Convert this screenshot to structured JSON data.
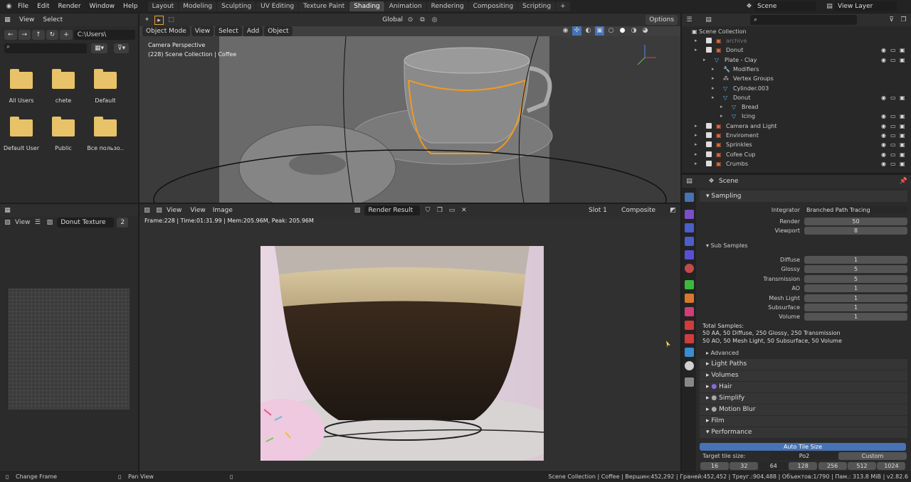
{
  "topbar": {
    "menus": [
      "File",
      "Edit",
      "Render",
      "Window",
      "Help"
    ],
    "workspaces": [
      "Layout",
      "Modeling",
      "Sculpting",
      "UV Editing",
      "Texture Paint",
      "Shading",
      "Animation",
      "Rendering",
      "Compositing",
      "Scripting"
    ],
    "scene": "Scene",
    "view_layer": "View Layer"
  },
  "file_browser": {
    "view": "View",
    "select": "Select",
    "path": "C:\\Users\\",
    "folders": [
      "All Users",
      "chete",
      "Default",
      "Default User",
      "Public",
      "Все пользо.."
    ]
  },
  "viewport": {
    "mode": "Object Mode",
    "menus": [
      "View",
      "Select",
      "Add",
      "Object"
    ],
    "transform": "Global",
    "options": "Options",
    "camera_label": "Camera Perspective",
    "collection_label": "(228) Scene Collection | Coffee"
  },
  "image_editor_left": {
    "view": "View",
    "image_name": "Donut Texture",
    "users": "2"
  },
  "image_editor": {
    "view": "View",
    "view2": "View",
    "image": "Image",
    "render_result": "Render Result",
    "slot": "Slot 1",
    "composite": "Composite",
    "frame_info": "Frame:228 | Time:01:31.99 | Mem:205.96M, Peak: 205.96M"
  },
  "outliner": {
    "title": "Scene Collection",
    "rows": [
      {
        "label": "archive",
        "indent": 0,
        "type": "collection",
        "dim": true
      },
      {
        "label": "Donut",
        "indent": 0,
        "type": "collection"
      },
      {
        "label": "Plate - Clay",
        "indent": 1,
        "type": "mesh"
      },
      {
        "label": "Modifiers",
        "indent": 2,
        "type": "wrench"
      },
      {
        "label": "Vertex Groups",
        "indent": 2,
        "type": "groups"
      },
      {
        "label": "Cylinder.003",
        "indent": 2,
        "type": "mesh"
      },
      {
        "label": "Donut",
        "indent": 2,
        "type": "mesh"
      },
      {
        "label": "Bread",
        "indent": 3,
        "type": "mesh"
      },
      {
        "label": "Icing",
        "indent": 3,
        "type": "mesh"
      },
      {
        "label": "Camera and Light",
        "indent": 0,
        "type": "collection"
      },
      {
        "label": "Enviroment",
        "indent": 0,
        "type": "collection"
      },
      {
        "label": "Sprinkles",
        "indent": 0,
        "type": "collection"
      },
      {
        "label": "Cofee Cup",
        "indent": 0,
        "type": "collection"
      },
      {
        "label": "Crumbs",
        "indent": 0,
        "type": "collection"
      }
    ]
  },
  "properties": {
    "context": "Scene",
    "sampling": "Sampling",
    "integrator_label": "Integrator",
    "integrator": "Branched Path Tracing",
    "render_label": "Render",
    "render_val": "50",
    "viewport_label": "Viewport",
    "viewport_val": "8",
    "sub_samples": "Sub Samples",
    "subs": [
      {
        "label": "Diffuse",
        "value": "1"
      },
      {
        "label": "Glossy",
        "value": "5"
      },
      {
        "label": "Transmission",
        "value": "5"
      },
      {
        "label": "AO",
        "value": "1"
      },
      {
        "label": "Mesh Light",
        "value": "1"
      },
      {
        "label": "Subsurface",
        "value": "1"
      },
      {
        "label": "Volume",
        "value": "1"
      }
    ],
    "total_title": "Total Samples:",
    "total_line1": "50 AA, 50 Diffuse, 250 Glossy, 250 Transmission",
    "total_line2": "50 AO, 50 Mesh Light, 50 Subsurface, 50 Volume",
    "advanced": "Advanced",
    "panels": [
      "Light Paths",
      "Volumes",
      "Hair",
      "Simplify",
      "Motion Blur",
      "Film",
      "Performance"
    ],
    "auto_tile": "Auto Tile Size",
    "target_tile": "Target tile size:",
    "po2": "Po2",
    "custom": "Custom",
    "tiles": [
      "16",
      "32",
      "64",
      "128",
      "256",
      "512",
      "1024"
    ]
  },
  "status": {
    "left": "Change Frame",
    "mid": "Pan View",
    "right": "Scene Collection | Coffee | Вершин:452,292 | Граней:452,452 | Треуг.:904,488 | Объектов:1/790 | Пам.: 313.8 MiB | v2.82.6"
  }
}
